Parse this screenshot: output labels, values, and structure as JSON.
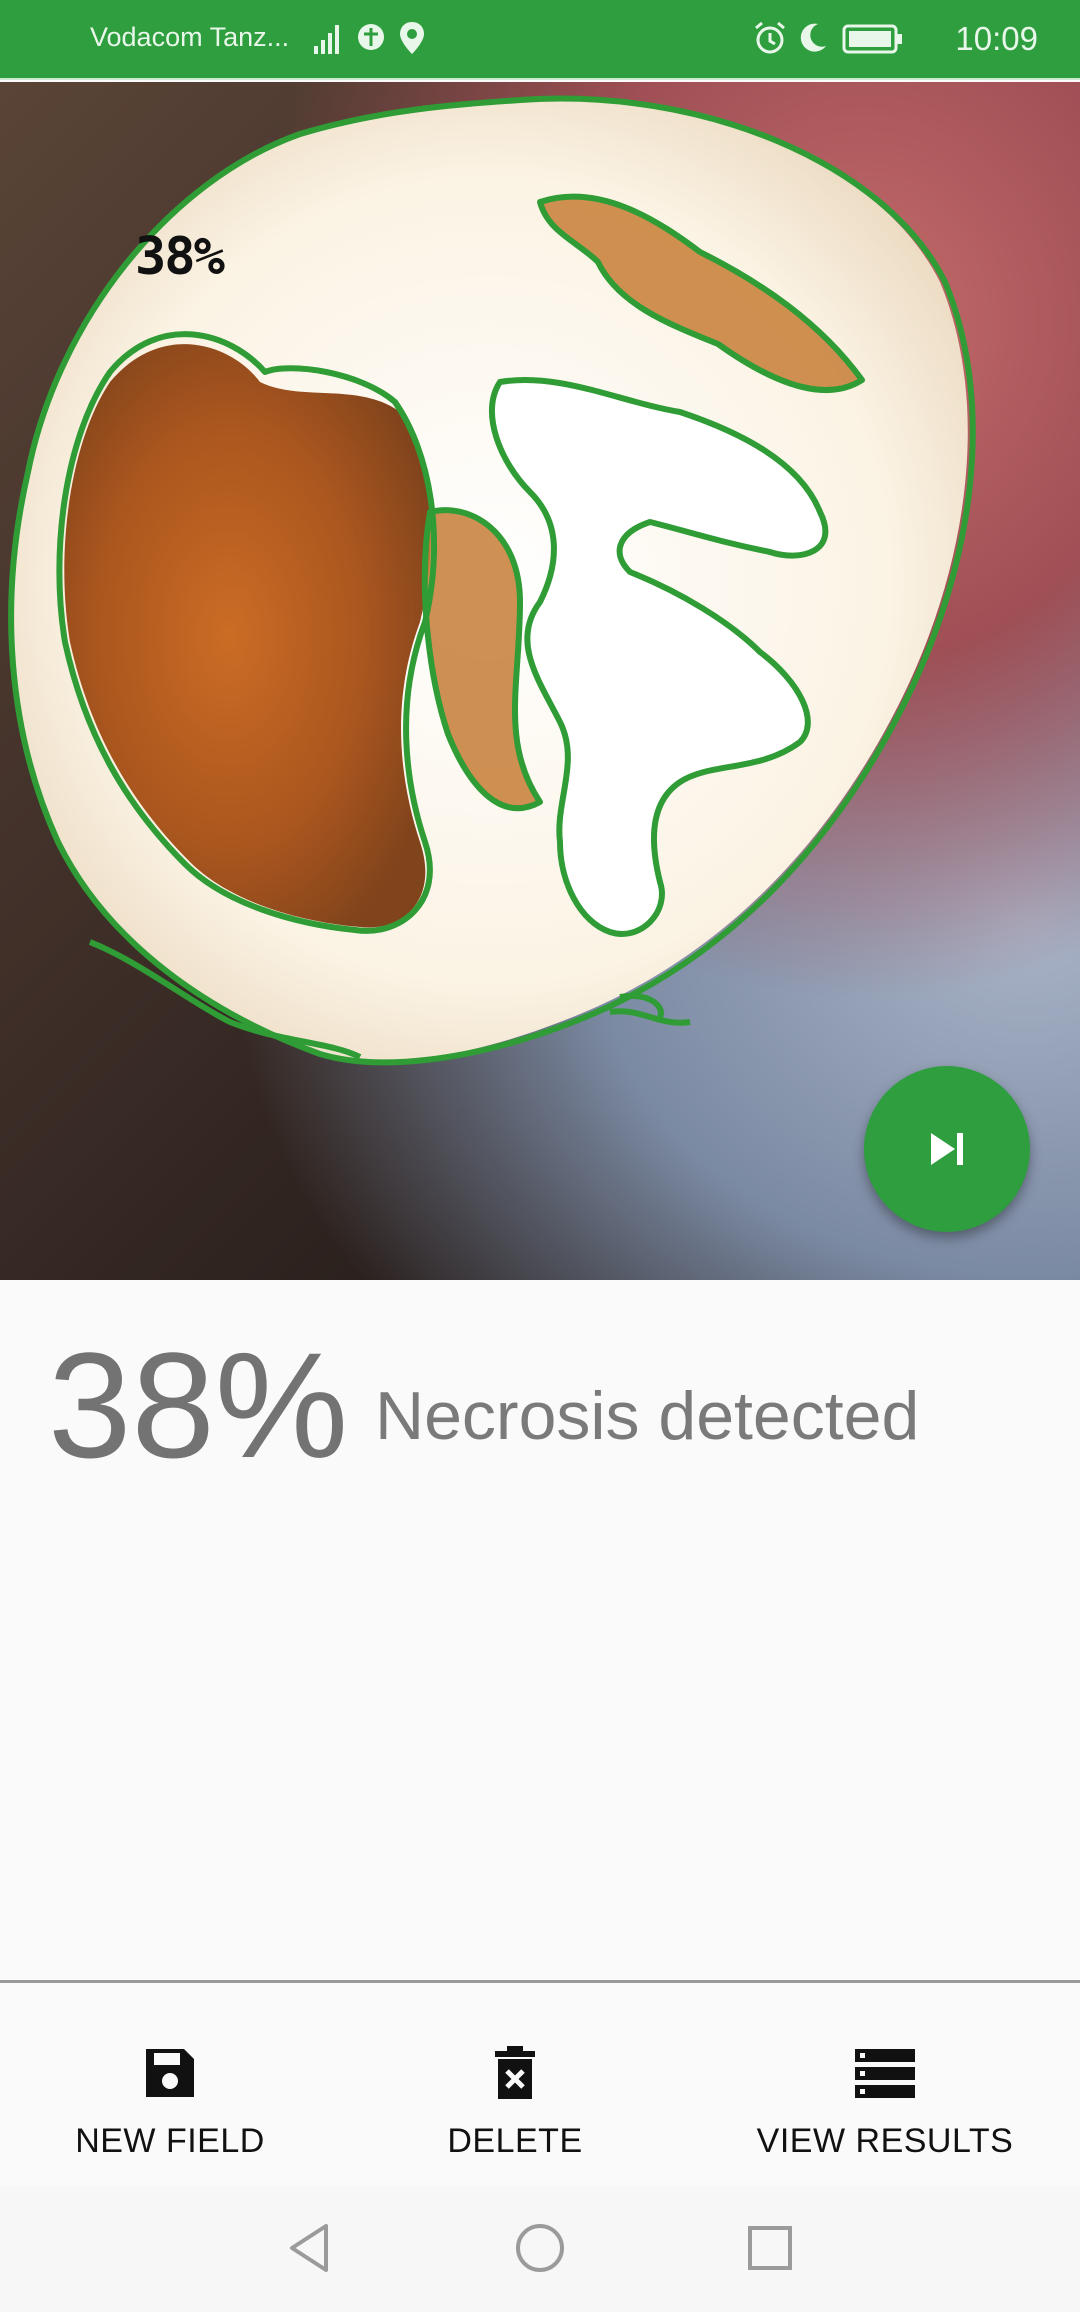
{
  "status_bar": {
    "carrier": "Vodacom Tanz...",
    "icons": [
      "signal-icon",
      "data-icon",
      "location-icon",
      "alarm-icon",
      "moon-icon",
      "battery-icon"
    ],
    "time": "10:09",
    "background_color": "#2e9e3e"
  },
  "photo": {
    "overlay_label": "38%",
    "outline_color": "#2f9c35"
  },
  "fab": {
    "icon": "skip-next-icon"
  },
  "result": {
    "percent": "38%",
    "label": "Necrosis detected"
  },
  "bottom_nav": {
    "items": [
      {
        "label": "NEW FIELD",
        "icon": "save-icon"
      },
      {
        "label": "DELETE",
        "icon": "delete-icon"
      },
      {
        "label": "VIEW RESULTS",
        "icon": "list-icon"
      }
    ]
  },
  "system_nav": {
    "icons": [
      "back-icon",
      "home-icon",
      "recents-icon"
    ]
  }
}
